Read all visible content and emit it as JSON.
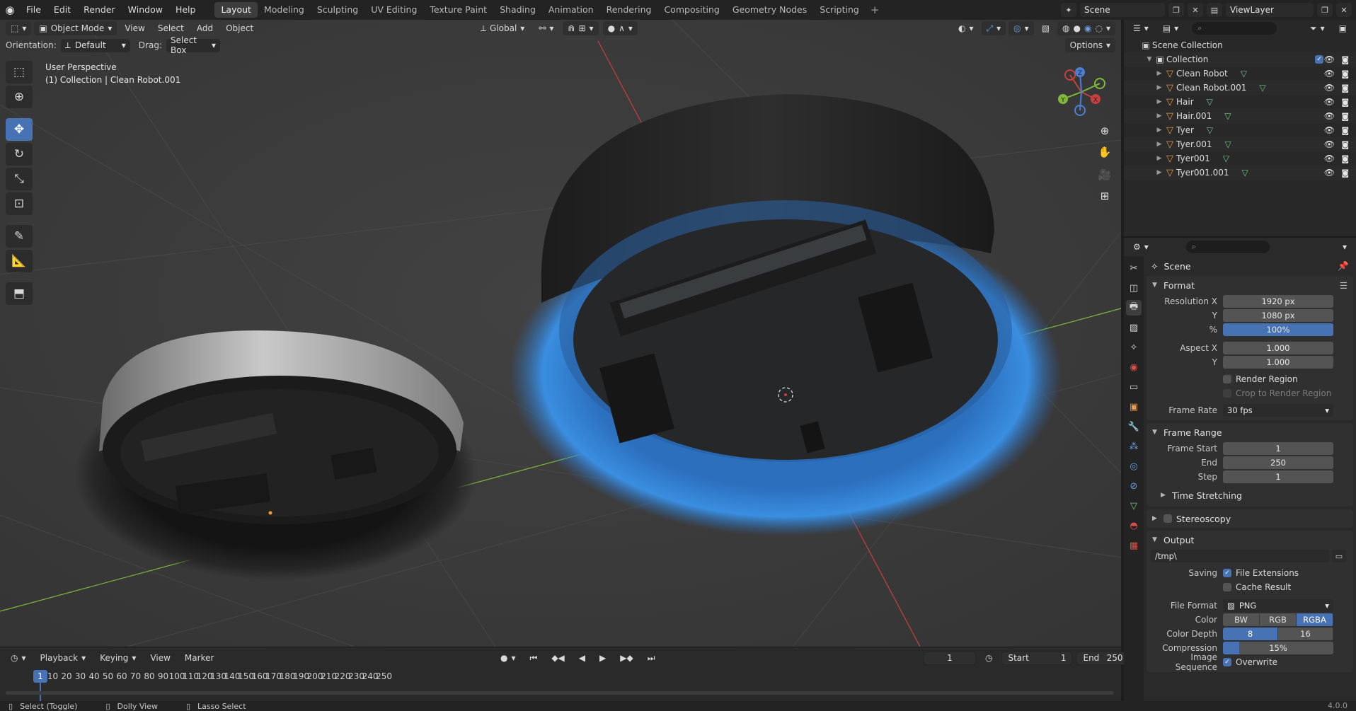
{
  "topbar": {
    "menus": [
      "File",
      "Edit",
      "Render",
      "Window",
      "Help"
    ],
    "workspaces": [
      "Layout",
      "Modeling",
      "Sculpting",
      "UV Editing",
      "Texture Paint",
      "Shading",
      "Animation",
      "Rendering",
      "Compositing",
      "Geometry Nodes",
      "Scripting"
    ],
    "active_workspace": "Layout",
    "scene_name": "Scene",
    "view_layer": "ViewLayer"
  },
  "viewport": {
    "mode": "Object Mode",
    "menus": [
      "View",
      "Select",
      "Add",
      "Object"
    ],
    "orientation_label": "Orientation:",
    "orientation_value": "Default",
    "drag_label": "Drag:",
    "drag_value": "Select Box",
    "transform_orientation": "Global",
    "options_label": "Options",
    "overlay_line1": "User Perspective",
    "overlay_line2": "(1) Collection | Clean Robot.001",
    "gizmo": {
      "x": "X",
      "y": "Y",
      "z": "Z"
    }
  },
  "timeline": {
    "menus": [
      "Playback",
      "Keying",
      "View",
      "Marker"
    ],
    "current_frame": "1",
    "start_label": "Start",
    "start": "1",
    "end_label": "End",
    "end": "250",
    "ticks": [
      "1",
      "10",
      "20",
      "30",
      "40",
      "50",
      "60",
      "70",
      "80",
      "90",
      "100",
      "110",
      "120",
      "130",
      "140",
      "150",
      "160",
      "170",
      "180",
      "190",
      "200",
      "210",
      "220",
      "230",
      "240",
      "250"
    ]
  },
  "statusbar": {
    "items": [
      "Select (Toggle)",
      "Dolly View",
      "Lasso Select"
    ],
    "version": "4.0.0"
  },
  "outliner": {
    "root": "Scene Collection",
    "collection": "Collection",
    "objects": [
      "Clean Robot",
      "Clean Robot.001",
      "Hair",
      "Hair.001",
      "Tyer",
      "Tyer.001",
      "Tyer001",
      "Tyer001.001"
    ]
  },
  "properties": {
    "context": "Scene",
    "format": {
      "title": "Format",
      "res_x_label": "Resolution X",
      "res_x": "1920 px",
      "res_y_label": "Y",
      "res_y": "1080 px",
      "res_pct_label": "%",
      "res_pct": "100%",
      "aspect_x_label": "Aspect X",
      "aspect_x": "1.000",
      "aspect_y_label": "Y",
      "aspect_y": "1.000",
      "render_region": "Render Region",
      "crop_region": "Crop to Render Region",
      "frame_rate_label": "Frame Rate",
      "frame_rate": "30 fps"
    },
    "frame_range": {
      "title": "Frame Range",
      "start_label": "Frame Start",
      "start": "1",
      "end_label": "End",
      "end": "250",
      "step_label": "Step",
      "step": "1",
      "time_stretching": "Time Stretching"
    },
    "stereoscopy": "Stereoscopy",
    "output": {
      "title": "Output",
      "path": "/tmp\\",
      "saving_label": "Saving",
      "file_extensions": "File Extensions",
      "cache_result": "Cache Result",
      "file_format_label": "File Format",
      "file_format": "PNG",
      "color_label": "Color",
      "color_options": [
        "BW",
        "RGB",
        "RGBA"
      ],
      "color_selected": "RGBA",
      "color_depth_label": "Color Depth",
      "depth_options": [
        "8",
        "16"
      ],
      "depth_selected": "8",
      "compression_label": "Compression",
      "compression": "15%",
      "compression_fraction": 0.15,
      "image_sequence_label": "Image Sequence",
      "overwrite": "Overwrite"
    }
  },
  "colors": {
    "accent": "#4772b3",
    "x_axis": "#c8403d",
    "y_axis": "#7fb83a",
    "fur_blue": "#2f78c8"
  }
}
